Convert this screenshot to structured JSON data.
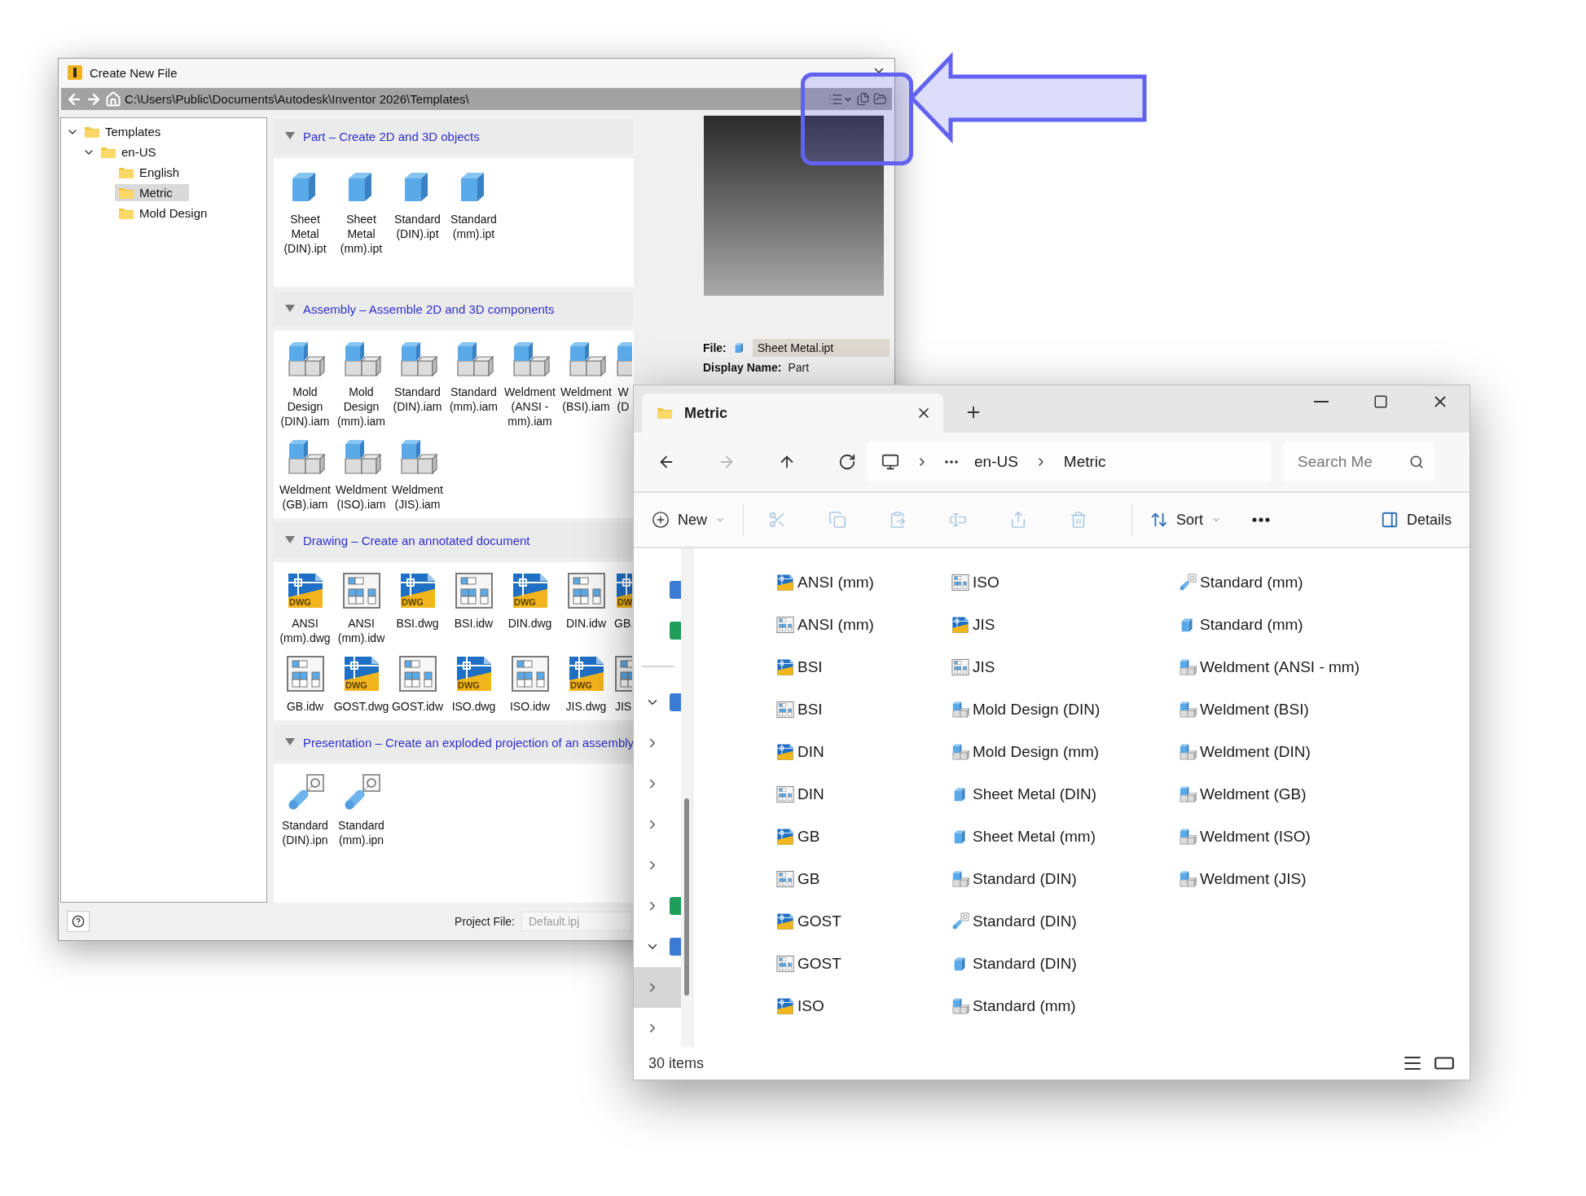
{
  "inventor_dialog": {
    "title": "Create New File",
    "path": "C:\\Users\\Public\\Documents\\Autodesk\\Inventor 2026\\Templates\\",
    "tree": [
      {
        "label": "Templates",
        "expanded": true,
        "selected": false,
        "children": [
          {
            "label": "en-US",
            "expanded": true,
            "selected": false,
            "children": [
              {
                "label": "English",
                "selected": false
              },
              {
                "label": "Metric",
                "selected": true
              },
              {
                "label": "Mold Design",
                "selected": false
              }
            ]
          }
        ]
      }
    ],
    "sections": [
      {
        "title": "Part – Create 2D and 3D objects",
        "expanded": true,
        "items": [
          {
            "kind": "ipt",
            "label": "Sheet Metal (DIN).ipt"
          },
          {
            "kind": "ipt",
            "label": "Sheet Metal (mm).ipt"
          },
          {
            "kind": "ipt",
            "label": "Standard (DIN).ipt"
          },
          {
            "kind": "ipt",
            "label": "Standard (mm).ipt"
          }
        ]
      },
      {
        "title": "Assembly – Assemble 2D and 3D components",
        "expanded": true,
        "items": [
          {
            "kind": "iam",
            "label": "Mold Design (DIN).iam"
          },
          {
            "kind": "iam",
            "label": "Mold Design (mm).iam"
          },
          {
            "kind": "iam",
            "label": "Standard (DIN).iam"
          },
          {
            "kind": "iam",
            "label": "Standard (mm).iam"
          },
          {
            "kind": "iam",
            "label": "Weldment (ANSI - mm).iam"
          },
          {
            "kind": "iam",
            "label": "Weldment (BSI).iam"
          },
          {
            "kind": "iam",
            "label": "W\n(D"
          },
          {
            "kind": "iam",
            "label": "Weldment (GB).iam"
          },
          {
            "kind": "iam",
            "label": "Weldment (ISO).iam"
          },
          {
            "kind": "iam",
            "label": "Weldment (JIS).iam"
          }
        ]
      },
      {
        "title": "Drawing – Create an annotated document",
        "expanded": true,
        "items": [
          {
            "kind": "dwg",
            "badge": "DWG",
            "label": "ANSI (mm).dwg"
          },
          {
            "kind": "idw",
            "label": "ANSI (mm).idw"
          },
          {
            "kind": "dwg",
            "badge": "DWG",
            "label": "BSI.dwg"
          },
          {
            "kind": "idw",
            "label": "BSI.idw"
          },
          {
            "kind": "dwg",
            "badge": "DWG",
            "label": "DIN.dwg"
          },
          {
            "kind": "idw",
            "label": "DIN.idw"
          },
          {
            "kind": "dwg",
            "badge": "DW",
            "label": "GB."
          },
          {
            "kind": "idw",
            "label": "GB.idw"
          },
          {
            "kind": "dwg",
            "badge": "DWG",
            "label": "GOST.dwg"
          },
          {
            "kind": "idw",
            "label": "GOST.idw"
          },
          {
            "kind": "dwg",
            "badge": "DWG",
            "label": "ISO.dwg"
          },
          {
            "kind": "idw",
            "label": "ISO.idw"
          },
          {
            "kind": "dwg",
            "badge": "DWG",
            "label": "JIS.dwg"
          },
          {
            "kind": "idw",
            "label": "JIS"
          }
        ]
      },
      {
        "title": "Presentation – Create an exploded projection of an assembly",
        "expanded": true,
        "items": [
          {
            "kind": "ipn",
            "label": "Standard (DIN).ipn"
          },
          {
            "kind": "ipn",
            "label": "Standard (mm).ipn"
          }
        ]
      }
    ],
    "preview": {
      "file_label": "File:",
      "file": "Sheet Metal.ipt",
      "display_name_label": "Display Name:",
      "display_name": "Part"
    },
    "project_file": {
      "label": "Project File:",
      "value": "Default.ipj"
    }
  },
  "explorer": {
    "tab": {
      "title": "Metric"
    },
    "nav_buttons": [
      {
        "kind": "back",
        "disabled": false
      },
      {
        "kind": "forward",
        "disabled": true
      },
      {
        "kind": "up",
        "disabled": false
      },
      {
        "kind": "refresh",
        "disabled": false
      }
    ],
    "breadcrumb": [
      "en-US",
      "Metric"
    ],
    "search": {
      "placeholder": "Search Me"
    },
    "new_button": "New",
    "clipboard_actions": [
      {
        "kind": "cut",
        "disabled": true
      },
      {
        "kind": "copy",
        "disabled": true
      },
      {
        "kind": "paste",
        "disabled": true
      },
      {
        "kind": "rename",
        "disabled": true
      },
      {
        "kind": "share",
        "disabled": true
      },
      {
        "kind": "delete",
        "disabled": true
      }
    ],
    "sort_button": "Sort",
    "details_button": "Details",
    "nav_pane": [
      {
        "kind": "icon"
      },
      {
        "kind": "icon"
      },
      {
        "kind": "divider"
      },
      {
        "kind": "node_icon",
        "expanded": true,
        "selected": false
      },
      {
        "kind": "node",
        "expanded": false,
        "selected": false
      },
      {
        "kind": "node",
        "expanded": false,
        "selected": false
      },
      {
        "kind": "node",
        "expanded": false,
        "selected": false
      },
      {
        "kind": "node",
        "expanded": false,
        "selected": false
      },
      {
        "kind": "node_icon",
        "expanded": false,
        "selected": false
      },
      {
        "kind": "node_icon",
        "expanded": true,
        "selected": false
      },
      {
        "kind": "node",
        "expanded": false,
        "selected": true
      },
      {
        "kind": "node",
        "expanded": false,
        "selected": false
      }
    ],
    "files": [
      {
        "name": "ANSI (mm)",
        "kind": "dwg"
      },
      {
        "name": "ANSI (mm)",
        "kind": "idw"
      },
      {
        "name": "BSI",
        "kind": "dwg"
      },
      {
        "name": "BSI",
        "kind": "idw"
      },
      {
        "name": "DIN",
        "kind": "dwg"
      },
      {
        "name": "DIN",
        "kind": "idw"
      },
      {
        "name": "GB",
        "kind": "dwg"
      },
      {
        "name": "GB",
        "kind": "idw"
      },
      {
        "name": "GOST",
        "kind": "dwg"
      },
      {
        "name": "GOST",
        "kind": "idw"
      },
      {
        "name": "ISO",
        "kind": "dwg"
      },
      {
        "name": "ISO",
        "kind": "idw"
      },
      {
        "name": "JIS",
        "kind": "dwg"
      },
      {
        "name": "JIS",
        "kind": "idw"
      },
      {
        "name": "Mold Design (DIN)",
        "kind": "iam"
      },
      {
        "name": "Mold Design (mm)",
        "kind": "iam"
      },
      {
        "name": "Sheet Metal (DIN)",
        "kind": "ipt"
      },
      {
        "name": "Sheet Metal (mm)",
        "kind": "ipt"
      },
      {
        "name": "Standard (DIN)",
        "kind": "iam"
      },
      {
        "name": "Standard (DIN)",
        "kind": "ipn"
      },
      {
        "name": "Standard (DIN)",
        "kind": "ipt"
      },
      {
        "name": "Standard (mm)",
        "kind": "iam"
      },
      {
        "name": "Standard (mm)",
        "kind": "ipn"
      },
      {
        "name": "Standard (mm)",
        "kind": "ipt"
      },
      {
        "name": "Weldment (ANSI - mm)",
        "kind": "iam"
      },
      {
        "name": "Weldment (BSI)",
        "kind": "iam"
      },
      {
        "name": "Weldment (DIN)",
        "kind": "iam"
      },
      {
        "name": "Weldment (GB)",
        "kind": "iam"
      },
      {
        "name": "Weldment (ISO)",
        "kind": "iam"
      },
      {
        "name": "Weldment (JIS)",
        "kind": "iam"
      }
    ],
    "status": "30 items"
  }
}
